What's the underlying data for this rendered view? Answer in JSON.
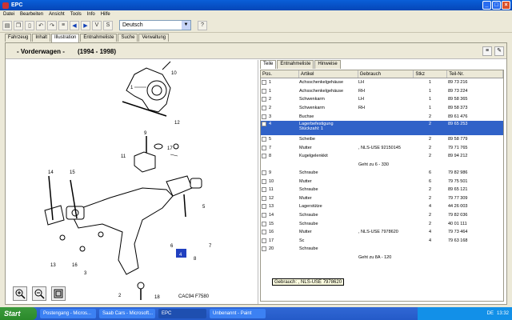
{
  "window": {
    "title": "EPC"
  },
  "menu": [
    "Datei",
    "Bearbeiten",
    "Ansicht",
    "Tools",
    "Info",
    "Hilfe"
  ],
  "language": {
    "value": "Deutsch"
  },
  "tabs": [
    "Fahrzeug",
    "Inhalt",
    "Illustration",
    "Entnahmeliste",
    "Suche",
    "Verwaltung"
  ],
  "header": {
    "title": "- Vorderwagen -",
    "years": "(1994 - 1998)"
  },
  "illustration": {
    "caption": "CAC94 F7580",
    "callouts": [
      "1",
      "2",
      "3",
      "4",
      "5",
      "6",
      "7",
      "8",
      "9",
      "10",
      "11",
      "12",
      "13",
      "14",
      "15",
      "16",
      "17",
      "18"
    ]
  },
  "parts_tabs": [
    "Teile",
    "Entnahmeliste",
    "Hinweise"
  ],
  "grid": {
    "columns": [
      "Pos.",
      "Artikel",
      "Gebrauch",
      "Stkz",
      "Teil-Nr."
    ],
    "rows": [
      {
        "pos": "1",
        "artikel": "Achsschenkelgehäuse",
        "gebrauch": "LH",
        "stkz": "1",
        "teil": "89 73 216"
      },
      {
        "pos": "1",
        "artikel": "Achsschenkelgehäuse",
        "gebrauch": "RH",
        "stkz": "1",
        "teil": "89 73 224"
      },
      {
        "pos": "2",
        "artikel": "Schwenkarm",
        "gebrauch": "LH",
        "stkz": "1",
        "teil": "89 58 365"
      },
      {
        "pos": "2",
        "artikel": "Schwenkarm",
        "gebrauch": "RH",
        "stkz": "1",
        "teil": "89 58 373"
      },
      {
        "pos": "3",
        "artikel": "Buchse",
        "gebrauch": "",
        "stkz": "2",
        "teil": "89 61 476"
      },
      {
        "pos": "4",
        "artikel": "Lagerbefestigung",
        "gebrauch": "",
        "stkz": "2",
        "teil": "89 65 253",
        "selected": true,
        "note": "Stückzahl: 1"
      },
      {
        "pos": "5",
        "artikel": "Scheibe",
        "gebrauch": "",
        "stkz": "2",
        "teil": "89 58 779"
      },
      {
        "pos": "7",
        "artikel": "Mutter",
        "gebrauch": ", NLS-USE 92150145",
        "stkz": "2",
        "teil": "79 71 765"
      },
      {
        "pos": "8",
        "artikel": "Kugelgelenkkit",
        "gebrauch": "",
        "stkz": "2",
        "teil": "89 94 212",
        "note": "Geht zu 6 - 330"
      },
      {
        "pos": "9",
        "artikel": "Schraube",
        "gebrauch": "",
        "stkz": "6",
        "teil": "79 82 986"
      },
      {
        "pos": "10",
        "artikel": "Mutter",
        "gebrauch": "",
        "stkz": "6",
        "teil": "79 75 501"
      },
      {
        "pos": "11",
        "artikel": "Schraube",
        "gebrauch": "",
        "stkz": "2",
        "teil": "89 65 121"
      },
      {
        "pos": "12",
        "artikel": "Mutter",
        "gebrauch": "",
        "stkz": "2",
        "teil": "79 77 309"
      },
      {
        "pos": "13",
        "artikel": "Lagerstütze",
        "gebrauch": "",
        "stkz": "4",
        "teil": "44 26 003"
      },
      {
        "pos": "14",
        "artikel": "Schraube",
        "gebrauch": "",
        "stkz": "2",
        "teil": "79 82 036"
      },
      {
        "pos": "15",
        "artikel": "Schraube",
        "gebrauch": "",
        "stkz": "2",
        "teil": "40 01 111"
      },
      {
        "pos": "16",
        "artikel": "Mutter",
        "gebrauch": ", NLS-USE 7978620",
        "stkz": "4",
        "teil": "79 73 464"
      },
      {
        "pos": "17",
        "artikel": "Sc",
        "gebrauch": "",
        "stkz": "4",
        "teil": "79 63 168"
      },
      {
        "pos": "20",
        "artikel": "Schraube",
        "gebrauch": "",
        "stkz": "",
        "teil": "",
        "note": "Geht zu 8A - 120"
      }
    ]
  },
  "tooltip": "Gebrauch: , NLS-USE 7978620",
  "taskbar": {
    "start": "Start",
    "items": [
      "Postengang - Micros...",
      "Saab Cars - Microsoft...",
      "EPC",
      "Unbenannt - Paint"
    ],
    "active": 2,
    "lang": "DE",
    "clock": "13:32"
  },
  "colors": {
    "selection": "#3062c8",
    "titlebar": "#0a5fd8",
    "taskbar": "#245ac8"
  }
}
